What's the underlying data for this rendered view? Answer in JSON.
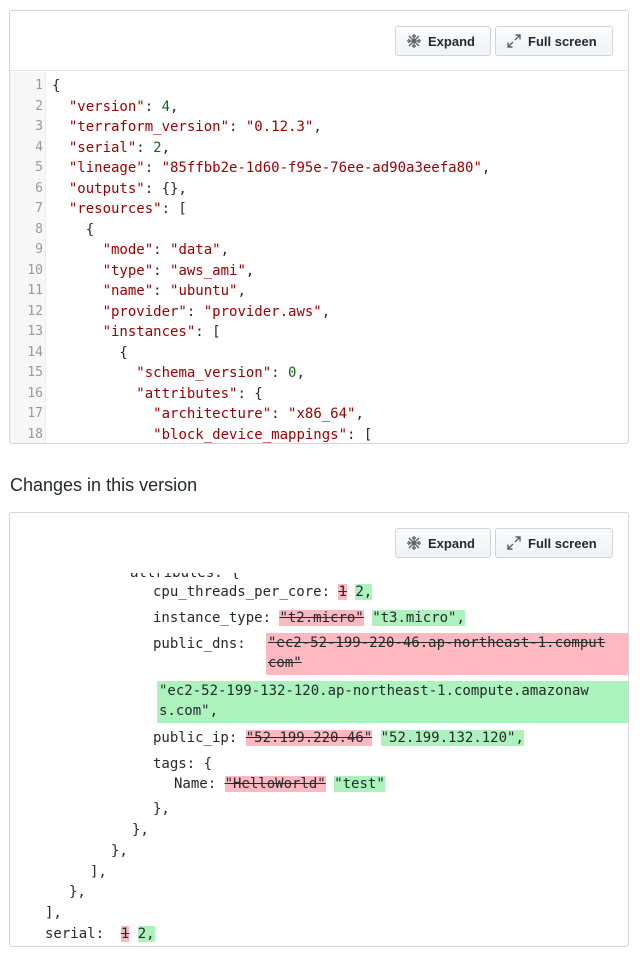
{
  "toolbar": {
    "expand_label": "Expand",
    "fullscreen_label": "Full screen"
  },
  "code_lines": [
    {
      "n": "1",
      "t": "{"
    },
    {
      "n": "2",
      "t": "  \"version\": 4,"
    },
    {
      "n": "3",
      "t": "  \"terraform_version\": \"0.12.3\","
    },
    {
      "n": "4",
      "t": "  \"serial\": 2,"
    },
    {
      "n": "5",
      "t": "  \"lineage\": \"85ffbb2e-1d60-f95e-76ee-ad90a3eefa80\","
    },
    {
      "n": "6",
      "t": "  \"outputs\": {},"
    },
    {
      "n": "7",
      "t": "  \"resources\": ["
    },
    {
      "n": "8",
      "t": "    {"
    },
    {
      "n": "9",
      "t": "      \"mode\": \"data\","
    },
    {
      "n": "10",
      "t": "      \"type\": \"aws_ami\","
    },
    {
      "n": "11",
      "t": "      \"name\": \"ubuntu\","
    },
    {
      "n": "12",
      "t": "      \"provider\": \"provider.aws\","
    },
    {
      "n": "13",
      "t": "      \"instances\": ["
    },
    {
      "n": "14",
      "t": "        {"
    },
    {
      "n": "15",
      "t": "          \"schema_version\": 0,"
    },
    {
      "n": "16",
      "t": "          \"attributes\": {"
    },
    {
      "n": "17",
      "t": "            \"architecture\": \"x86_64\","
    },
    {
      "n": "18",
      "t": "            \"block_device_mappings\": ["
    }
  ],
  "changes_title": "Changes in this version",
  "diff": {
    "partial_top": "attributes: {",
    "cpu_key": "cpu_threads_per_core:",
    "cpu_old": "1",
    "cpu_new": "2,",
    "itype_key": "instance_type:",
    "itype_old": "\"t2.micro\"",
    "itype_new": "\"t3.micro\",",
    "dns_key": "public_dns:",
    "dns_old_1": "\"ec2-52-199-220-46.ap-northeast-1.comput",
    "dns_old_2": "com\"",
    "dns_new_1": "\"ec2-52-199-132-120.ap-northeast-1.compute.amazonaw",
    "dns_new_2": "s.com\",",
    "ip_key": "public_ip:",
    "ip_old": "\"52.199.220.46\"",
    "ip_new": "\"52.199.132.120\",",
    "tags_key": "tags: {",
    "name_key": "Name:",
    "name_old": "\"HelloWorld\"",
    "name_new": "\"test\"",
    "close_1": "},",
    "close_2": "},",
    "close_3": "},",
    "close_4": "],",
    "close_5": "},",
    "close_6": "],",
    "serial_key": "serial:",
    "serial_old": "1",
    "serial_new": "2,"
  }
}
